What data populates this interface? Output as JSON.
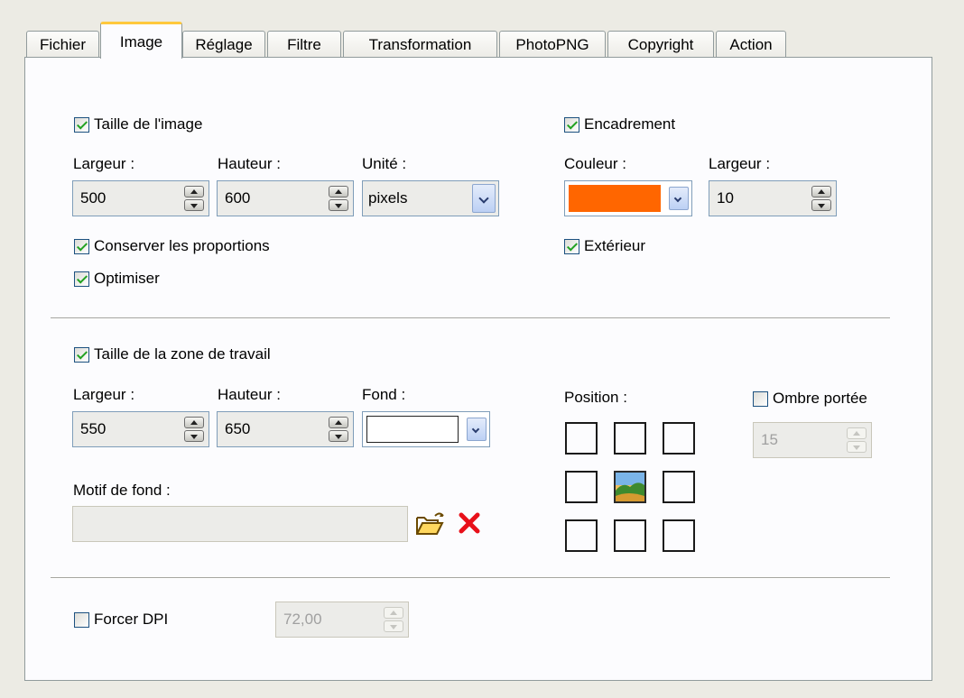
{
  "tabs": [
    "Fichier",
    "Image",
    "Réglage",
    "Filtre",
    "Transformation",
    "PhotoPNG",
    "Copyright",
    "Action"
  ],
  "active_tab": "Image",
  "image_size": {
    "checkbox_label": "Taille de l'image",
    "checked": true,
    "width_label": "Largeur :",
    "width_value": "500",
    "height_label": "Hauteur :",
    "height_value": "600",
    "unit_label": "Unité :",
    "unit_value": "pixels",
    "keep_ratio_label": "Conserver les proportions",
    "keep_ratio_checked": true,
    "optimize_label": "Optimiser",
    "optimize_checked": true
  },
  "frame": {
    "checkbox_label": "Encadrement",
    "checked": true,
    "color_label": "Couleur :",
    "color": "#ff6600",
    "width_label": "Largeur :",
    "width_value": "10",
    "outside_label": "Extérieur",
    "outside_checked": true
  },
  "workspace": {
    "checkbox_label": "Taille de la zone de travail",
    "checked": true,
    "width_label": "Largeur :",
    "width_value": "550",
    "height_label": "Hauteur :",
    "height_value": "650",
    "background_label": "Fond :",
    "pattern_label": "Motif de fond :",
    "pattern_value": "",
    "position_label": "Position :",
    "position_selected": "center",
    "shadow_label": "Ombre portée",
    "shadow_checked": false,
    "shadow_value": "15"
  },
  "dpi": {
    "checkbox_label": "Forcer DPI",
    "checked": false,
    "value": "72,00"
  },
  "icons": {
    "open": "folder-open-icon",
    "delete": "delete-x-icon",
    "position_center": "landscape-image-icon"
  }
}
